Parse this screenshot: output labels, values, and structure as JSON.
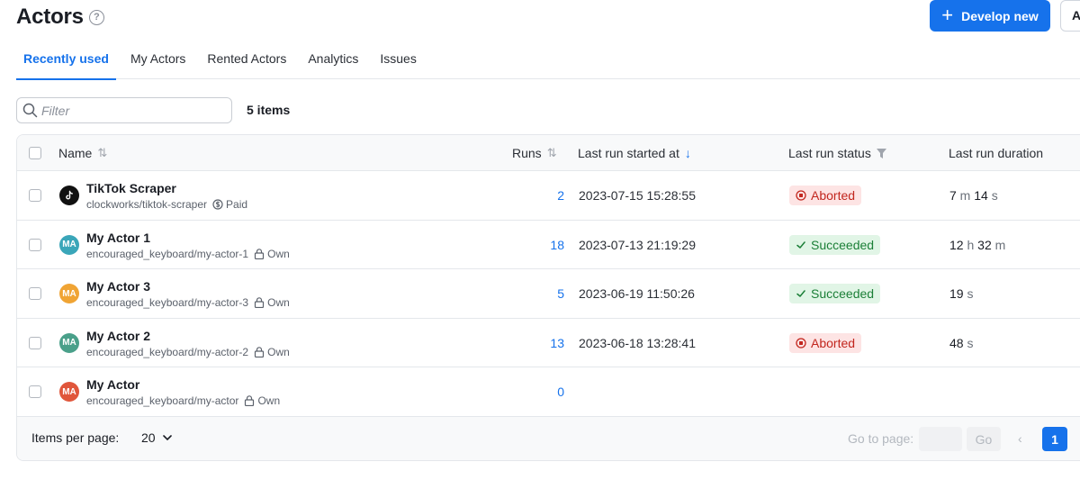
{
  "header": {
    "title": "Actors",
    "develop_label": "Develop new",
    "secondary_label": "A"
  },
  "tabs": [
    {
      "label": "Recently used",
      "active": true
    },
    {
      "label": "My Actors"
    },
    {
      "label": "Rented Actors"
    },
    {
      "label": "Analytics"
    },
    {
      "label": "Issues"
    }
  ],
  "filter": {
    "placeholder": "Filter",
    "items_count": "5 items"
  },
  "table": {
    "columns": {
      "name": "Name",
      "runs": "Runs",
      "last_started": "Last run started at",
      "last_status": "Last run status",
      "last_duration": "Last run duration"
    },
    "rows": [
      {
        "name": "TikTok Scraper",
        "slug": "clockworks/tiktok-scraper",
        "tag": "Paid",
        "tag_icon": "dollar-coin-icon",
        "avatar": "",
        "avatar_icon": "tiktok-logo-icon",
        "avatar_color": "#111111",
        "runs": "2",
        "started": "2023-07-15 15:28:55",
        "status": "Aborted",
        "status_type": "aborted",
        "duration": [
          {
            "n": "7",
            "u": "m"
          },
          {
            "n": "14",
            "u": "s"
          }
        ]
      },
      {
        "name": "My Actor 1",
        "slug": "encouraged_keyboard/my-actor-1",
        "tag": "Own",
        "tag_icon": "lock-icon",
        "avatar": "MA",
        "avatar_color": "#3aa6b9",
        "runs": "18",
        "started": "2023-07-13 21:19:29",
        "status": "Succeeded",
        "status_type": "succeeded",
        "duration": [
          {
            "n": "12",
            "u": "h"
          },
          {
            "n": "32",
            "u": "m"
          }
        ]
      },
      {
        "name": "My Actor 3",
        "slug": "encouraged_keyboard/my-actor-3",
        "tag": "Own",
        "tag_icon": "lock-icon",
        "avatar": "MA",
        "avatar_color": "#f0a434",
        "runs": "5",
        "started": "2023-06-19 11:50:26",
        "status": "Succeeded",
        "status_type": "succeeded",
        "duration": [
          {
            "n": "19",
            "u": "s"
          }
        ]
      },
      {
        "name": "My Actor 2",
        "slug": "encouraged_keyboard/my-actor-2",
        "tag": "Own",
        "tag_icon": "lock-icon",
        "avatar": "MA",
        "avatar_color": "#4aa08a",
        "runs": "13",
        "started": "2023-06-18 13:28:41",
        "status": "Aborted",
        "status_type": "aborted",
        "duration": [
          {
            "n": "48",
            "u": "s"
          }
        ]
      },
      {
        "name": "My Actor",
        "slug": "encouraged_keyboard/my-actor",
        "tag": "Own",
        "tag_icon": "lock-icon",
        "avatar": "MA",
        "avatar_color": "#e0563b",
        "runs": "0",
        "started": "",
        "status": "",
        "status_type": "",
        "duration": []
      }
    ]
  },
  "footer": {
    "per_page_label": "Items per page:",
    "per_page_value": "20",
    "goto_label": "Go to page:",
    "go_label": "Go",
    "current_page": "1"
  },
  "colors": {
    "primary": "#1672eb",
    "aborted_bg": "#fde4e4",
    "aborted_text": "#c2261e",
    "succeeded_bg": "#e1f5e6",
    "succeeded_text": "#1b7f37"
  }
}
